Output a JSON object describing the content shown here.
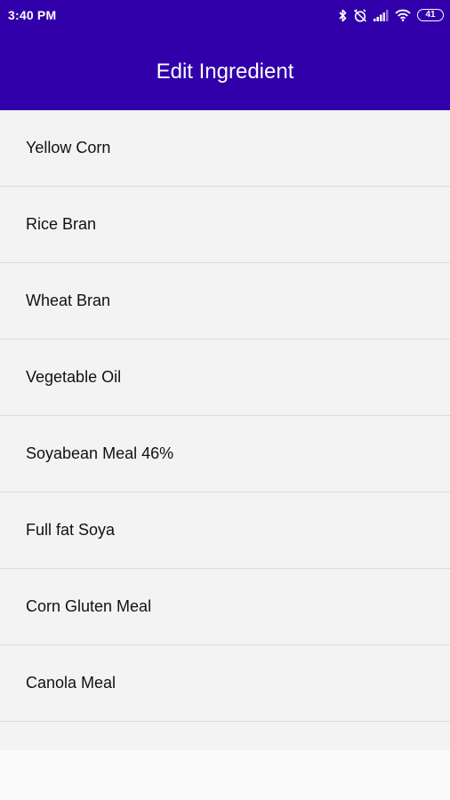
{
  "status_bar": {
    "time": "3:40 PM",
    "battery": "41",
    "icons": [
      "bluetooth-icon",
      "alarm-off-icon",
      "signal-icon",
      "wifi-icon",
      "battery-icon"
    ]
  },
  "header": {
    "title": "Edit Ingredient",
    "background_color": "#3100aa"
  },
  "ingredients": [
    {
      "label": "Yellow Corn"
    },
    {
      "label": "Rice Bran"
    },
    {
      "label": "Wheat Bran"
    },
    {
      "label": "Vegetable Oil"
    },
    {
      "label": "Soyabean Meal 46%"
    },
    {
      "label": "Full fat Soya"
    },
    {
      "label": "Corn Gluten Meal"
    },
    {
      "label": "Canola Meal"
    }
  ]
}
